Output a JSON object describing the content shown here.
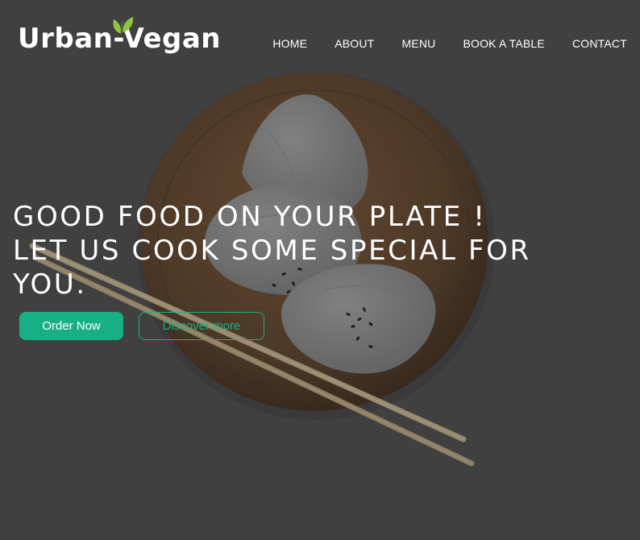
{
  "brand": {
    "name": "Urban-Vegan"
  },
  "nav": {
    "items": [
      {
        "label": "HOME"
      },
      {
        "label": "ABOUT"
      },
      {
        "label": "MENU"
      },
      {
        "label": "BOOK A TABLE"
      },
      {
        "label": "CONTACT"
      }
    ]
  },
  "hero": {
    "headline_lines": [
      "GOOD FOOD ON YOUR PLATE !",
      "LET US COOK SOME SPECIAL FOR",
      "YOU."
    ],
    "primary_button": "Order Now",
    "secondary_button": "Discover more"
  },
  "colors": {
    "accent": "#17b085",
    "leaf": "#8cc63f",
    "overlay": "#4a4a4c",
    "text": "#ffffff"
  }
}
